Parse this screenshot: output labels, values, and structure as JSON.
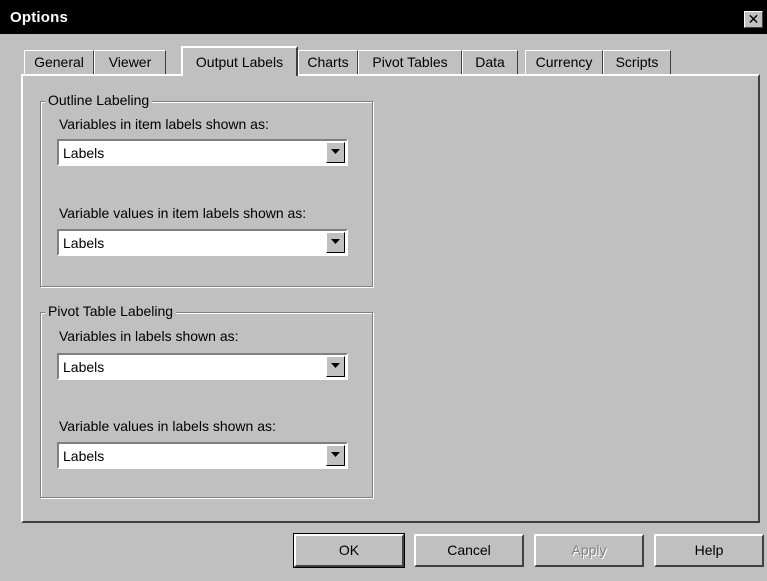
{
  "window": {
    "title": "Options",
    "close_glyph": "✕"
  },
  "tabs": [
    {
      "label": "General"
    },
    {
      "label": "Viewer"
    },
    {
      "label": "Output Labels"
    },
    {
      "label": "Charts"
    },
    {
      "label": "Pivot Tables"
    },
    {
      "label": "Data"
    },
    {
      "label": "Currency"
    },
    {
      "label": "Scripts"
    }
  ],
  "outline_labeling": {
    "title": "Outline Labeling",
    "variables_label": "Variables in item labels shown as:",
    "variables_value": "Labels",
    "values_label": "Variable values in item labels shown as:",
    "values_value": "Labels"
  },
  "pivot_labeling": {
    "title": "Pivot Table Labeling",
    "variables_label": "Variables in labels shown as:",
    "variables_value": "Labels",
    "values_label": "Variable values in labels shown as:",
    "values_value": "Labels"
  },
  "buttons": {
    "ok": "OK",
    "cancel": "Cancel",
    "apply": "Apply",
    "help": "Help"
  },
  "icons": {
    "dropdown": "chevron-down-icon",
    "close": "close-icon"
  }
}
